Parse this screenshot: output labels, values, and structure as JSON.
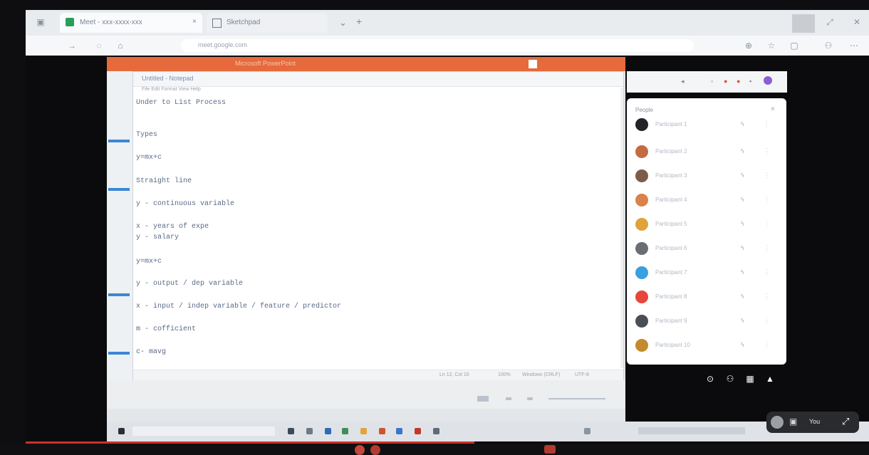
{
  "browser": {
    "tabs": [
      {
        "label": "Meet - xxx-xxxx-xxx"
      },
      {
        "label": "Sketchpad"
      }
    ],
    "new_tab": "+",
    "url": "meet.google.com"
  },
  "presentation": {
    "window_title": "Microsoft PowerPoint"
  },
  "notepad": {
    "title": "Untitled - Notepad",
    "menu": "File  Edit  Format  View  Help",
    "lines": [
      "Under to List Process",
      "Types",
      "y=mx+c",
      "Straight line",
      "y - continuous variable",
      "x - years of expe",
      "y - salary",
      "y=mx+c",
      "y - output / dep variable",
      "x - input / indep variable / feature / predictor",
      "m - cofficient",
      "c- mavg"
    ],
    "status": {
      "position": "Ln 12, Col 10",
      "zoom": "100%",
      "eol": "Windows (CRLF)",
      "encoding": "UTF-8"
    }
  },
  "participants": {
    "title": "People",
    "list": [
      {
        "name": "Participant 1",
        "color": "#222326"
      },
      {
        "name": "Participant 2",
        "color": "#c46b43"
      },
      {
        "name": "Participant 3",
        "color": "#7b5c4a"
      },
      {
        "name": "Participant 4",
        "color": "#d9824b"
      },
      {
        "name": "Participant 5",
        "color": "#e0a23a"
      },
      {
        "name": "Participant 6",
        "color": "#6a6e74"
      },
      {
        "name": "Participant 7",
        "color": "#3aa0e0"
      },
      {
        "name": "Participant 8",
        "color": "#e6473a"
      },
      {
        "name": "Participant 9",
        "color": "#4a4f56"
      },
      {
        "name": "Participant 10",
        "color": "#c48a2e"
      }
    ]
  },
  "pill": {
    "label": "You"
  },
  "colors": {
    "ppt_orange": "#e66a3c",
    "recording_red": "#c9322a"
  }
}
